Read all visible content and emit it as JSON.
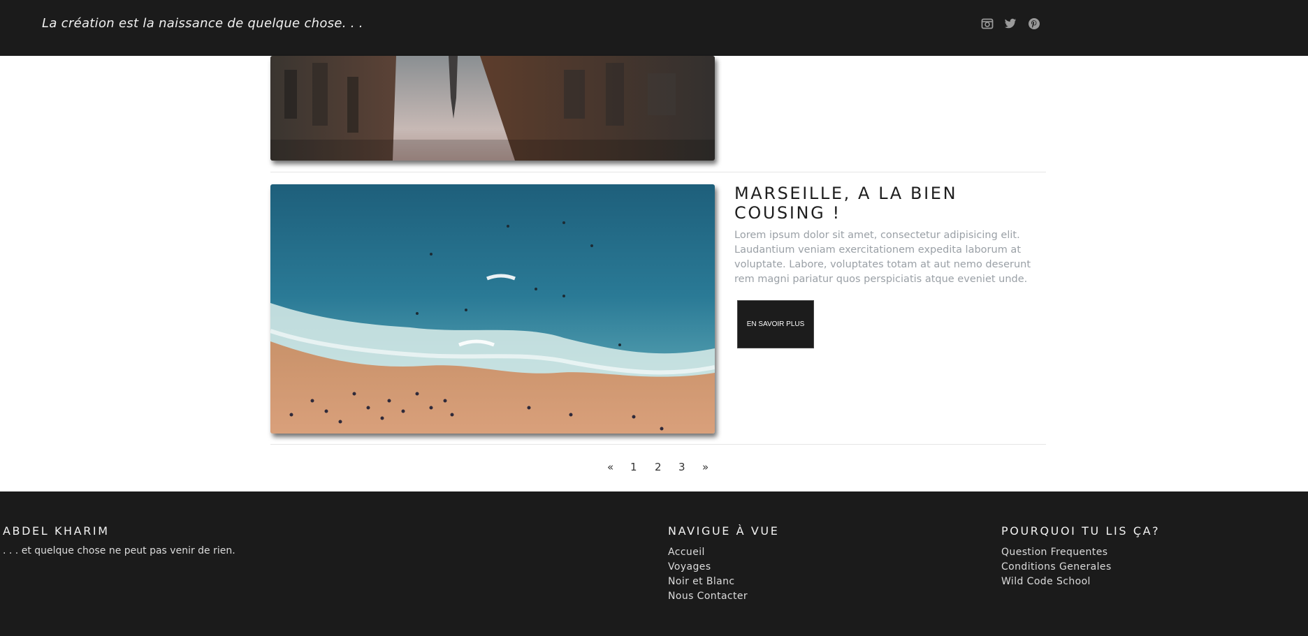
{
  "header": {
    "tagline": "La création est la naissance de quelque chose. . .",
    "social": [
      {
        "name": "instagram-icon"
      },
      {
        "name": "twitter-icon"
      },
      {
        "name": "pinterest-icon"
      }
    ]
  },
  "post": {
    "title": "MARSEILLE, A LA BIEN COUSING !",
    "excerpt": "Lorem ipsum dolor sit amet, consectetur adipisicing elit. Laudantium veniam exercitationem expedita laborum at voluptate. Labore, voluptates totam at aut nemo deserunt rem magni pariatur quos perspiciatis atque eveniet unde.",
    "button_label": "EN SAVOIR PLUS"
  },
  "pagination": {
    "prev": "«",
    "pages": [
      "1",
      "2",
      "3"
    ],
    "next": "»"
  },
  "footer": {
    "about": {
      "heading": "ABDEL KHARIM",
      "text": ". . . et quelque chose ne peut pas venir de rien."
    },
    "nav": {
      "heading": "NAVIGUE À VUE",
      "links": [
        "Accueil",
        "Voyages",
        "Noir et Blanc",
        "Nous Contacter"
      ]
    },
    "why": {
      "heading": "POURQUOI TU LIS ÇA?",
      "links": [
        "Question Frequentes",
        "Conditions Generales",
        "Wild Code School"
      ]
    }
  },
  "colors": {
    "dark": "#1b1b1b",
    "excerpt": "#9aa0a6"
  }
}
